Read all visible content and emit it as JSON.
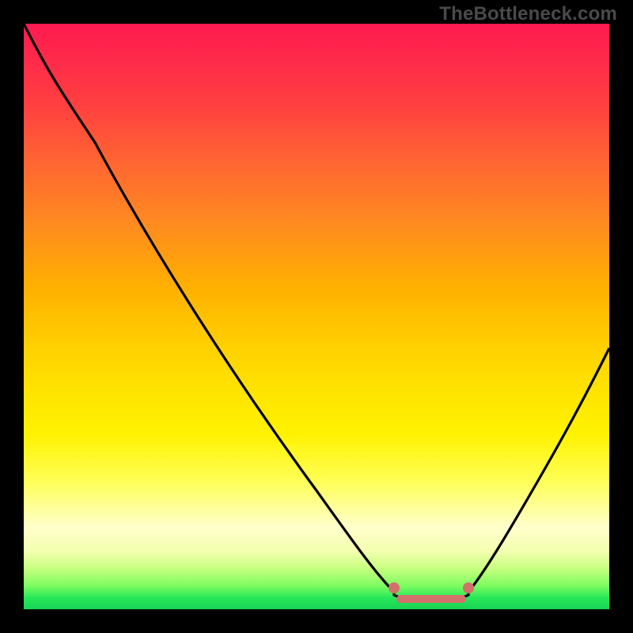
{
  "watermark": "TheBottleneck.com",
  "chart_data": {
    "type": "line",
    "title": "",
    "xlabel": "",
    "ylabel": "",
    "xlim": [
      0,
      100
    ],
    "ylim": [
      0,
      100
    ],
    "series": [
      {
        "name": "bottleneck-curve",
        "x": [
          0,
          4,
          8,
          15,
          25,
          35,
          45,
          55,
          60,
          63,
          67,
          73,
          76,
          80,
          85,
          90,
          95,
          100
        ],
        "values": [
          100,
          95,
          90,
          80,
          65,
          50,
          35,
          20,
          10,
          4,
          1,
          1,
          4,
          10,
          20,
          32,
          44,
          56
        ]
      }
    ],
    "flat_segment": {
      "x_start": 63,
      "x_end": 76,
      "y": 1.5
    },
    "gradient_stops": [
      {
        "pos": 0,
        "color": "#ff1a50"
      },
      {
        "pos": 25,
        "color": "#ff6a30"
      },
      {
        "pos": 55,
        "color": "#ffd000"
      },
      {
        "pos": 86,
        "color": "#ffffcc"
      },
      {
        "pos": 100,
        "color": "#17d455"
      }
    ]
  }
}
